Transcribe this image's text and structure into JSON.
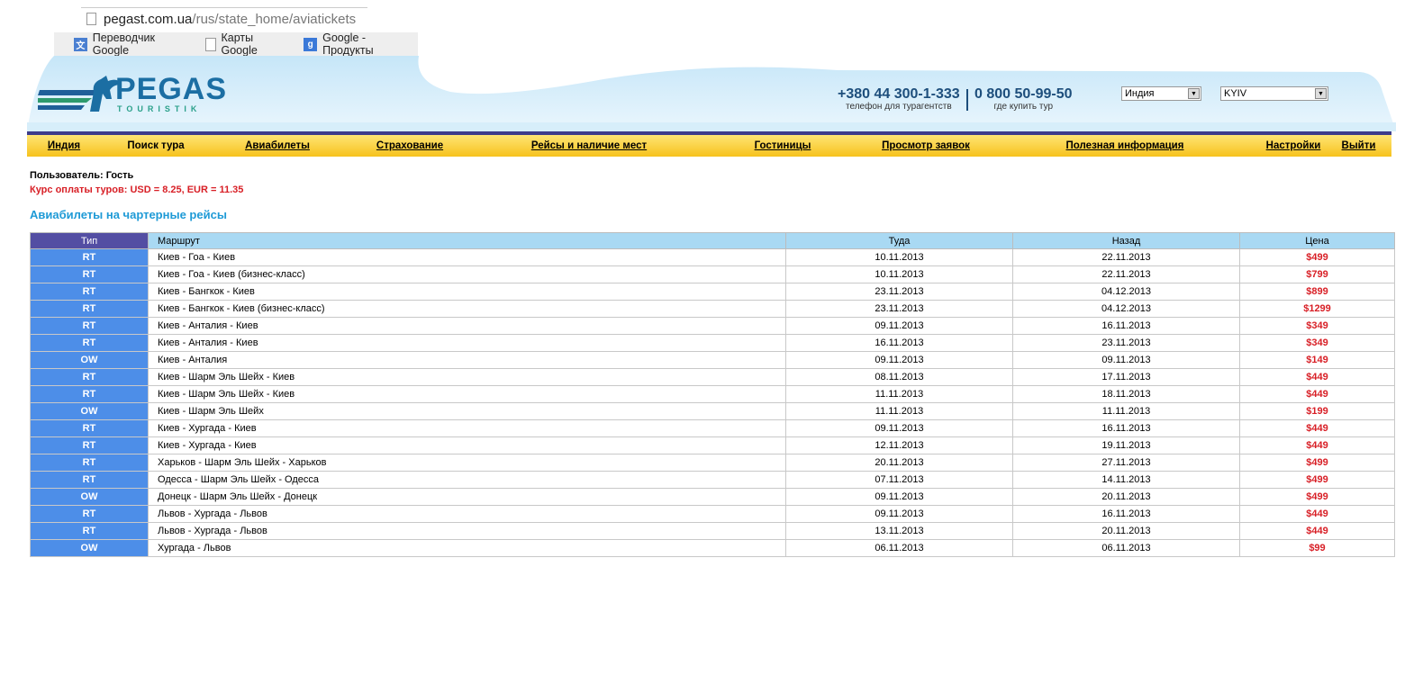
{
  "browser": {
    "url_domain": "pegast.com.ua",
    "url_path": "/rus/state_home/aviatickets",
    "bookmarks": [
      {
        "label": "Переводчик Google",
        "icon": "translate-icon"
      },
      {
        "label": "Карты Google",
        "icon": "page-icon"
      },
      {
        "label": "Google - Продукты",
        "icon": "google-plus-icon"
      }
    ]
  },
  "header": {
    "logo_text": "PEGAS",
    "logo_sub": "TOURISTIK",
    "phone1": {
      "number": "+380 44 300-1-333",
      "caption": "телефон для турагентств"
    },
    "phone2": {
      "number": "0 800 50-99-50",
      "caption": "где купить тур"
    },
    "country_select": "Индия",
    "city_select": "KYIV"
  },
  "nav": [
    {
      "label": "Индия",
      "underlined": true
    },
    {
      "label": "Поиск тура",
      "underlined": false
    },
    {
      "label": "Авиабилеты",
      "underlined": true
    },
    {
      "label": "Страхование",
      "underlined": true
    },
    {
      "label": "Рейсы и наличие мест",
      "underlined": true
    },
    {
      "label": "Гостиницы",
      "underlined": true
    },
    {
      "label": "Просмотр заявок",
      "underlined": true
    },
    {
      "label": "Полезная информация",
      "underlined": true
    },
    {
      "label": "Настройки",
      "underlined": true
    },
    {
      "label": "Выйти",
      "underlined": true
    }
  ],
  "user_line": "Пользователь: Гость",
  "rate_line": "Курс оплаты туров: USD = 8.25, EUR = 11.35",
  "page_title": "Авиабилеты на чартерные рейсы",
  "table": {
    "headers": {
      "type": "Тип",
      "route": "Маршрут",
      "there": "Туда",
      "back": "Назад",
      "price": "Цена"
    },
    "rows": [
      {
        "type": "RT",
        "route": "Киев - Гоа - Киев",
        "there": "10.11.2013",
        "back": "22.11.2013",
        "price": "$499"
      },
      {
        "type": "RT",
        "route": "Киев - Гоа - Киев (бизнес-класс)",
        "there": "10.11.2013",
        "back": "22.11.2013",
        "price": "$799"
      },
      {
        "type": "RT",
        "route": "Киев - Бангкок - Киев",
        "there": "23.11.2013",
        "back": "04.12.2013",
        "price": "$899"
      },
      {
        "type": "RT",
        "route": "Киев - Бангкок - Киев (бизнес-класс)",
        "there": "23.11.2013",
        "back": "04.12.2013",
        "price": "$1299"
      },
      {
        "type": "RT",
        "route": "Киев - Анталия - Киев",
        "there": "09.11.2013",
        "back": "16.11.2013",
        "price": "$349"
      },
      {
        "type": "RT",
        "route": "Киев - Анталия - Киев",
        "there": "16.11.2013",
        "back": "23.11.2013",
        "price": "$349"
      },
      {
        "type": "OW",
        "route": "Киев - Анталия",
        "there": "09.11.2013",
        "back": "09.11.2013",
        "price": "$149"
      },
      {
        "type": "RT",
        "route": "Киев - Шарм Эль Шейх - Киев",
        "there": "08.11.2013",
        "back": "17.11.2013",
        "price": "$449"
      },
      {
        "type": "RT",
        "route": "Киев - Шарм Эль Шейх - Киев",
        "there": "11.11.2013",
        "back": "18.11.2013",
        "price": "$449"
      },
      {
        "type": "OW",
        "route": "Киев - Шарм Эль Шейх",
        "there": "11.11.2013",
        "back": "11.11.2013",
        "price": "$199"
      },
      {
        "type": "RT",
        "route": "Киев - Хургада - Киев",
        "there": "09.11.2013",
        "back": "16.11.2013",
        "price": "$449"
      },
      {
        "type": "RT",
        "route": "Киев - Хургада - Киев",
        "there": "12.11.2013",
        "back": "19.11.2013",
        "price": "$449"
      },
      {
        "type": "RT",
        "route": "Харьков - Шарм Эль Шейх - Харьков",
        "there": "20.11.2013",
        "back": "27.11.2013",
        "price": "$499"
      },
      {
        "type": "RT",
        "route": "Одесса - Шарм Эль Шейх - Одесса",
        "there": "07.11.2013",
        "back": "14.11.2013",
        "price": "$499"
      },
      {
        "type": "OW",
        "route": "Донецк - Шарм Эль Шейх - Донецк",
        "there": "09.11.2013",
        "back": "20.11.2013",
        "price": "$499"
      },
      {
        "type": "RT",
        "route": "Львов - Хургада - Львов",
        "there": "09.11.2013",
        "back": "16.11.2013",
        "price": "$449"
      },
      {
        "type": "RT",
        "route": "Львов - Хургада - Львов",
        "there": "13.11.2013",
        "back": "20.11.2013",
        "price": "$449"
      },
      {
        "type": "OW",
        "route": "Хургада - Львов",
        "there": "06.11.2013",
        "back": "06.11.2013",
        "price": "$99"
      }
    ]
  },
  "colors": {
    "price_red": "#d81f26",
    "type_cell_blue": "#4d8ee8",
    "header_purple": "#534ea3",
    "nav_yellow": "#f6c21d",
    "title_blue": "#1e9ad6"
  }
}
